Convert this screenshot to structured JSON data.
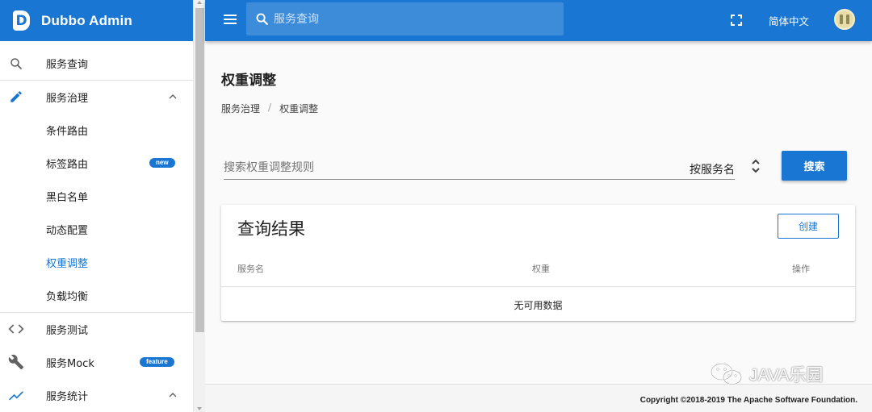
{
  "app": {
    "title": "Dubbo Admin",
    "logo_letter": "D",
    "brand_color": "#1976d2"
  },
  "sidebar": {
    "items": [
      {
        "label": "服务查询",
        "icon": "search-icon"
      },
      {
        "label": "服务治理",
        "icon": "pencil-icon",
        "expanded": true
      },
      {
        "label": "条件路由"
      },
      {
        "label": "标签路由",
        "badge": "new"
      },
      {
        "label": "黑白名单"
      },
      {
        "label": "动态配置"
      },
      {
        "label": "权重调整",
        "active": true
      },
      {
        "label": "负载均衡"
      },
      {
        "label": "服务测试",
        "icon": "code-icon"
      },
      {
        "label": "服务Mock",
        "icon": "wrench-icon",
        "badge": "feature"
      },
      {
        "label": "服务统计",
        "icon": "trend-icon",
        "expanded": true
      }
    ]
  },
  "topbar": {
    "search_placeholder": "服务查询",
    "language": "简体中文"
  },
  "main": {
    "page_title": "权重调整",
    "breadcrumb": [
      "服务治理",
      "权重调整"
    ],
    "breadcrumb_separator": "/",
    "rule_search_placeholder": "搜索权重调整规则",
    "filter_by": "按服务名",
    "search_button": "搜索",
    "results": {
      "title": "查询结果",
      "create_button": "创建",
      "columns": [
        "服务名",
        "权重",
        "操作"
      ],
      "empty_text": "无可用数据"
    }
  },
  "footer": {
    "copyright_prefix": "Copyright ©2018-2019 ",
    "copyright_org": "The Apache Software Foundation."
  },
  "watermark": {
    "text": "JAVA乐园"
  }
}
